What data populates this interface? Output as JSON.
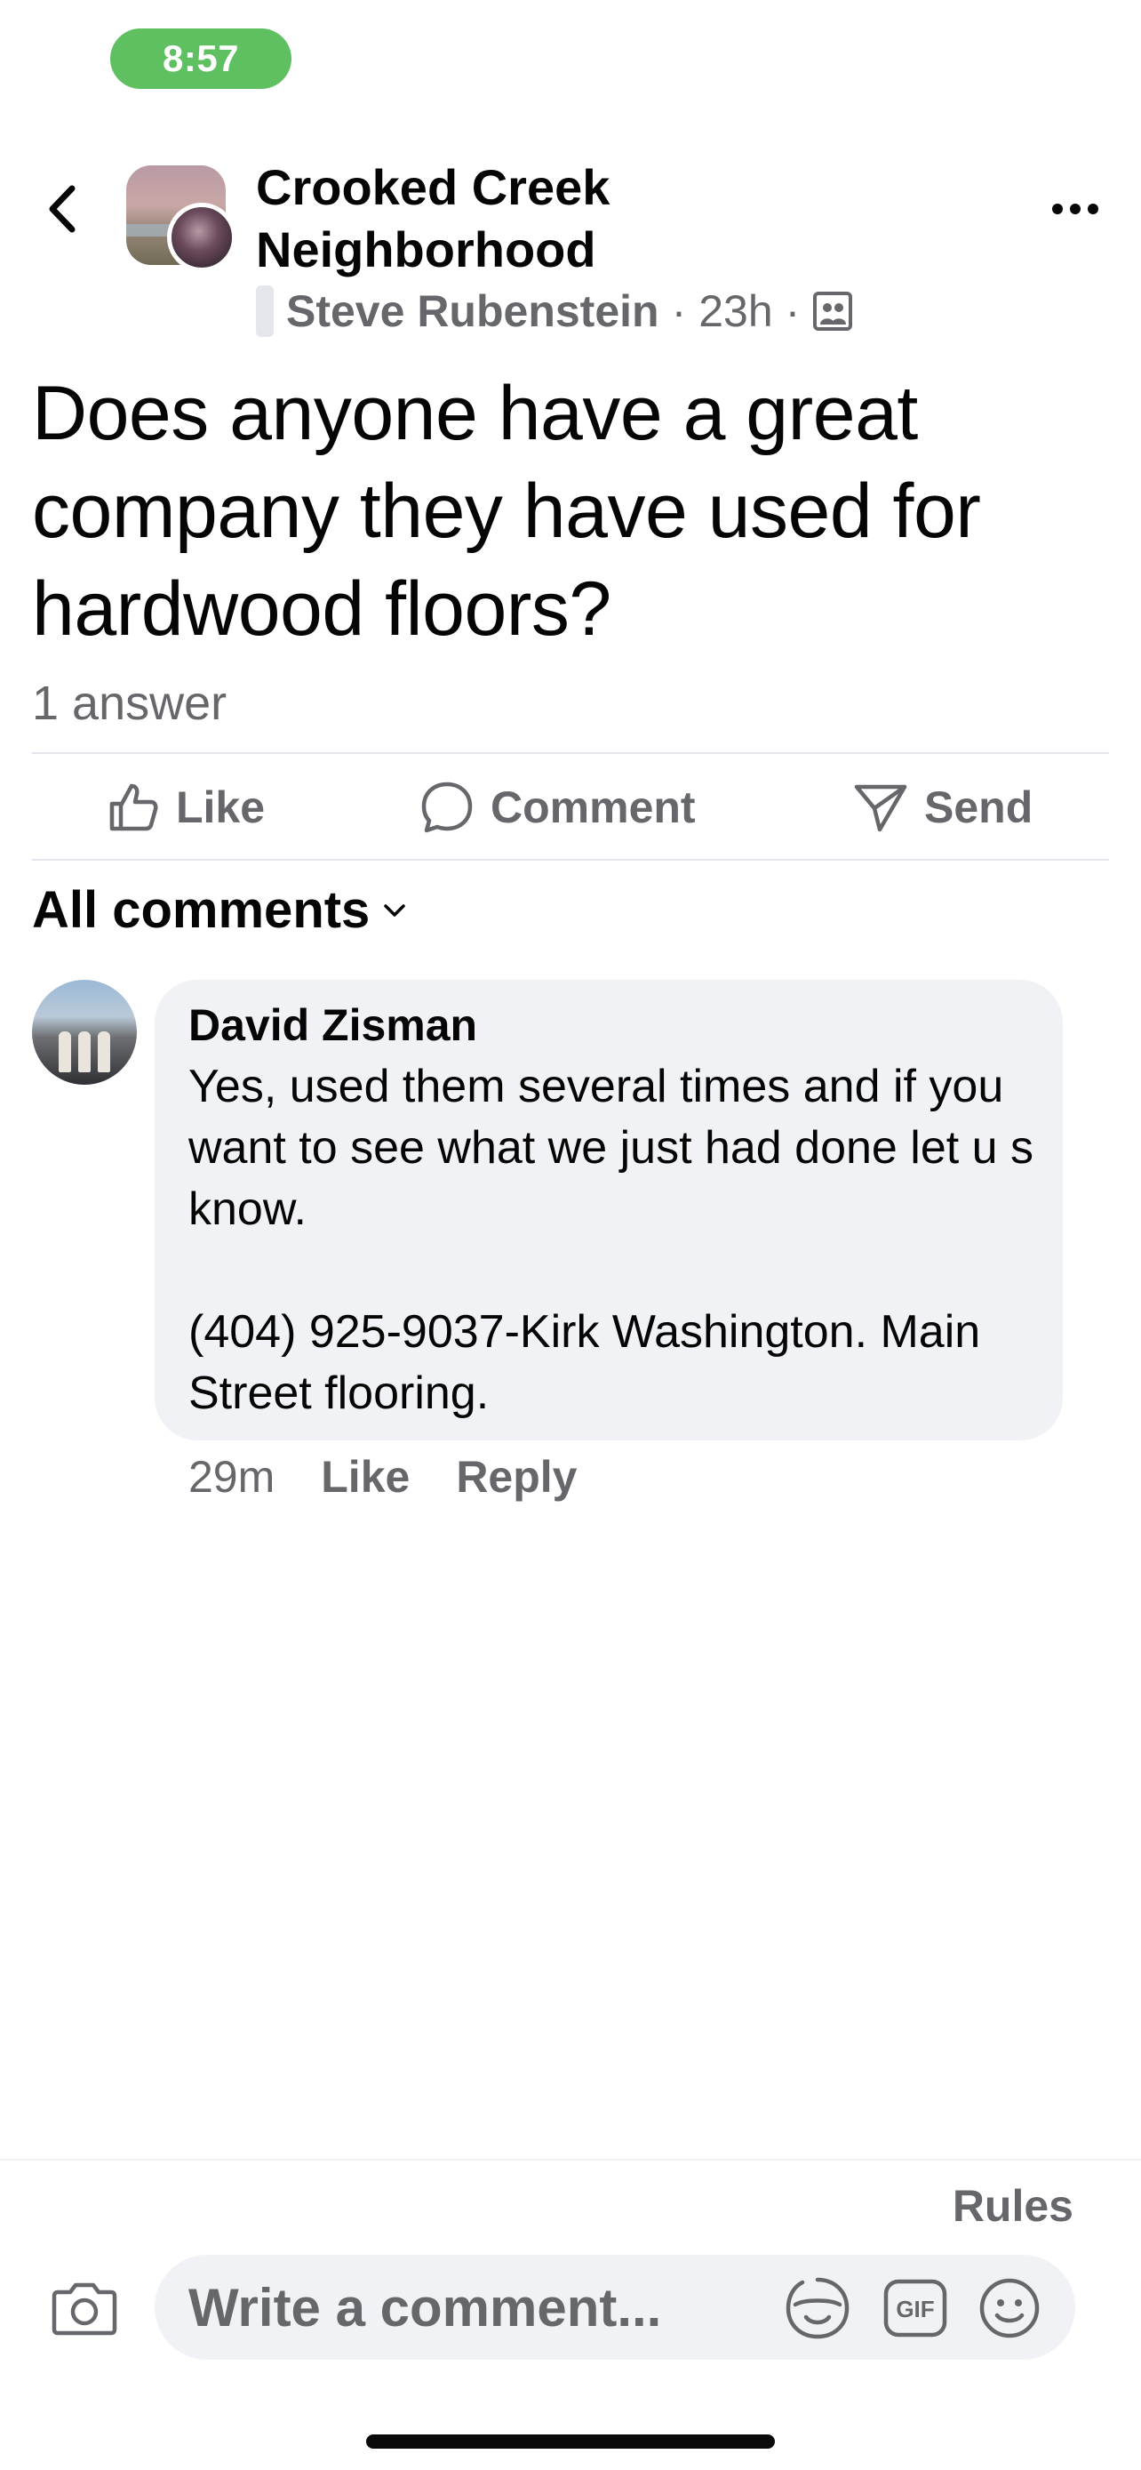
{
  "status_bar": {
    "time": "8:57"
  },
  "header": {
    "group_name": "Crooked Creek Neighborhood",
    "author": "Steve Rubenstein",
    "separator": "·",
    "time_ago": "23h",
    "privacy_icon": "group-members-icon"
  },
  "post": {
    "title": "Does anyone have a great company they have used for hardwood floors?",
    "answer_count": "1 answer"
  },
  "actions": {
    "like": "Like",
    "comment": "Comment",
    "send": "Send"
  },
  "comments_filter": "All comments",
  "comments": [
    {
      "name": "David Zisman",
      "text": "Yes, used them several times and if you want to see what we just had done let u s know.\n\n(404) 925-9037-Kirk Washington. Main Street flooring.",
      "time": "29m",
      "like": "Like",
      "reply": "Reply"
    }
  ],
  "composer": {
    "rules": "Rules",
    "placeholder": "Write a comment...",
    "gif": "GIF"
  },
  "colors": {
    "primary_text": "#050505",
    "secondary_text": "#65676b",
    "bubble_bg": "#f0f2f5",
    "status_pill": "#5fc061"
  }
}
